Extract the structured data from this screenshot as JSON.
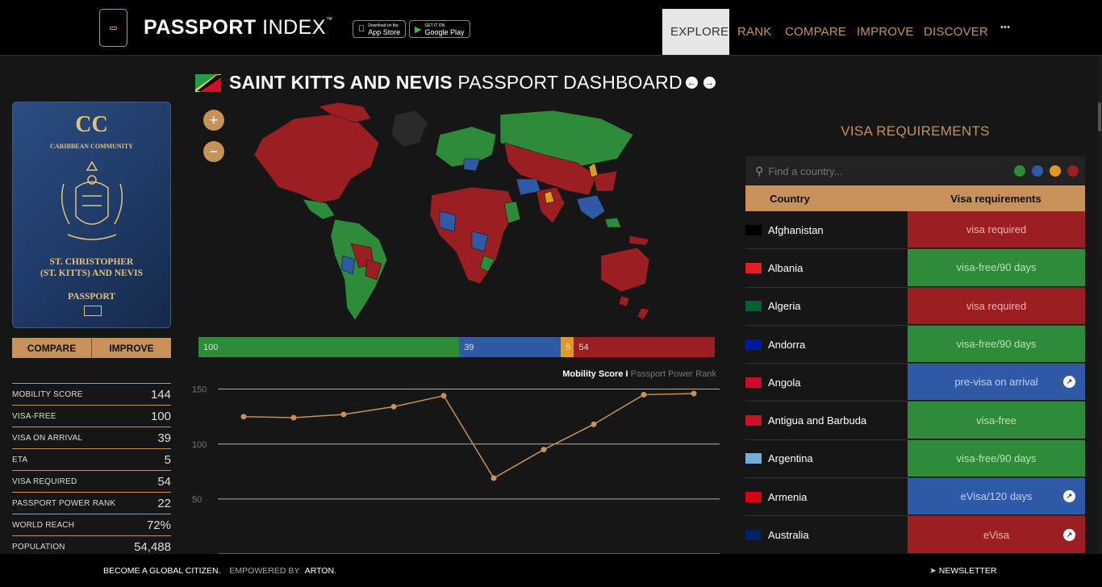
{
  "header": {
    "brand_bold": "PASSPORT",
    "brand_light": "INDEX",
    "brand_tm": "™",
    "appstore_small": "Download on the",
    "appstore_label": "App Store",
    "googleplay_small": "GET IT ON",
    "googleplay_label": "Google Play",
    "nav": [
      "EXPLORE",
      "RANK",
      "COMPARE",
      "IMPROVE",
      "DISCOVER"
    ],
    "more": "•••"
  },
  "passport_cover": {
    "emblem": "CC",
    "line1": "CARIBBEAN COMMUNITY",
    "line2": "ST. CHRISTOPHER",
    "line3": "(ST. KITTS) AND NEVIS",
    "line4": "PASSPORT"
  },
  "actions": {
    "compare": "COMPARE",
    "improve": "IMPROVE"
  },
  "stats": [
    {
      "k": "MOBILITY SCORE",
      "v": "144"
    },
    {
      "k": "VISA-FREE",
      "v": "100"
    },
    {
      "k": "VISA ON ARRIVAL",
      "v": "39"
    },
    {
      "k": "ETA",
      "v": "5"
    },
    {
      "k": "VISA REQUIRED",
      "v": "54"
    },
    {
      "k": "PASSPORT POWER RANK",
      "v": "22"
    },
    {
      "k": "WORLD REACH",
      "v": "72%"
    },
    {
      "k": "POPULATION",
      "v": "54,488"
    }
  ],
  "dashboard": {
    "country": "SAINT KITTS AND NEVIS",
    "suffix": "PASSPORT DASHBOARD",
    "zoom_in": "+",
    "zoom_out": "−"
  },
  "summary_bar": [
    {
      "label": "100",
      "value": 100,
      "color": "#2e8b3a"
    },
    {
      "label": "39",
      "value": 39,
      "color": "#2e5aa8"
    },
    {
      "label": "5",
      "value": 5,
      "color": "#e09a1f"
    },
    {
      "label": "54",
      "value": 54,
      "color": "#9b1f22"
    }
  ],
  "chart_legend": {
    "a": "Mobility Score",
    "sep": " I ",
    "b": "Passport Power Rank"
  },
  "chart_data": {
    "type": "line",
    "x": [
      1,
      2,
      3,
      4,
      5,
      6,
      7,
      8,
      9,
      10
    ],
    "series": [
      {
        "values": [
          125,
          124,
          127,
          134,
          144,
          69,
          95,
          118,
          145,
          146
        ]
      }
    ],
    "yticks": [
      "150",
      "100",
      "50"
    ],
    "ylim": [
      0,
      160
    ],
    "color": "#c7925a"
  },
  "visa": {
    "title": "VISA REQUIREMENTS",
    "search_placeholder": "Find a country...",
    "filter_colors": [
      "#2e8b3a",
      "#2e5aa8",
      "#e09a1f",
      "#9b1f22"
    ],
    "col_country": "Country",
    "col_req": "Visa requirements",
    "rows": [
      {
        "country": "Afghanistan",
        "req": "visa required",
        "color": "#9b1f22",
        "text": "#f0b0b0",
        "go": false
      },
      {
        "country": "Albania",
        "req": "visa-free/90 days",
        "color": "#2e8b3a",
        "text": "#b8e3b5",
        "go": false
      },
      {
        "country": "Algeria",
        "req": "visa required",
        "color": "#9b1f22",
        "text": "#f0b0b0",
        "go": false
      },
      {
        "country": "Andorra",
        "req": "visa-free/90 days",
        "color": "#2e8b3a",
        "text": "#b8e3b5",
        "go": false
      },
      {
        "country": "Angola",
        "req": "pre-visa on arrival",
        "color": "#2e5aa8",
        "text": "#c0d0f0",
        "go": true
      },
      {
        "country": "Antigua and Barbuda",
        "req": "visa-free",
        "color": "#2e8b3a",
        "text": "#b8e3b5",
        "go": false
      },
      {
        "country": "Argentina",
        "req": "visa-free/90 days",
        "color": "#2e8b3a",
        "text": "#b8e3b5",
        "go": false
      },
      {
        "country": "Armenia",
        "req": "eVisa/120 days",
        "color": "#2e5aa8",
        "text": "#c0d0f0",
        "go": true
      },
      {
        "country": "Australia",
        "req": "eVisa",
        "color": "#9b1f22",
        "text": "#f0b0b0",
        "go": true
      }
    ]
  },
  "footer": {
    "left": "BECOME A GLOBAL CITIZEN.",
    "middle": "EMPOWERED BY",
    "right": "ARTON.",
    "newsletter": "NEWSLETTER"
  }
}
